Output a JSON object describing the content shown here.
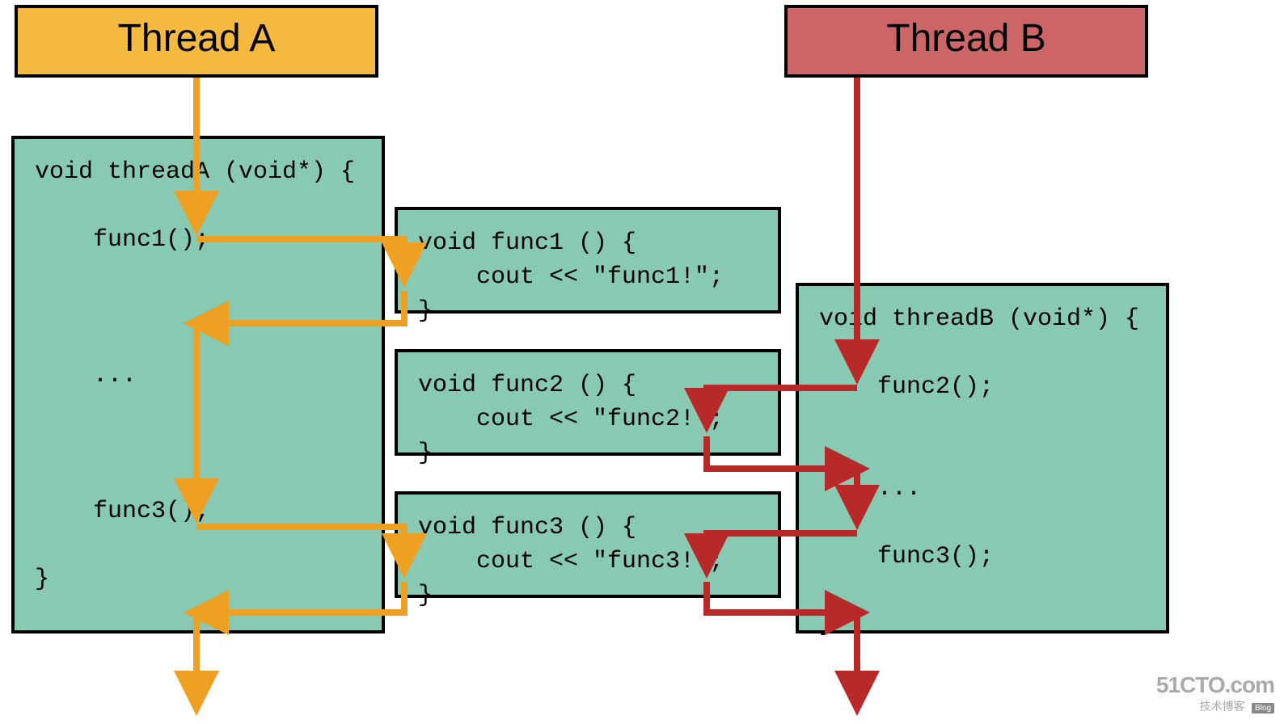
{
  "threadA": {
    "title": "Thread A"
  },
  "threadB": {
    "title": "Thread B"
  },
  "code": {
    "threadA": "void threadA (void*) {\n\n    func1();\n\n\n\n    ...\n\n\n\n    func3();\n\n}",
    "func1": "void func1 () {\n    cout << \"func1!\";\n}",
    "func2": "void func2 () {\n    cout << \"func2!\";\n}",
    "func3": "void func3 () {\n    cout << \"func3!\";\n}",
    "threadB": "void threadB (void*) {\n\n    func2();\n\n\n    ...\n\n    func3();\n\n}"
  },
  "colors": {
    "orange": "#eda021",
    "red": "#b82a2a"
  },
  "watermark": {
    "brand": "51CTO.com",
    "sub": "技术博客",
    "blog": "Blog"
  }
}
